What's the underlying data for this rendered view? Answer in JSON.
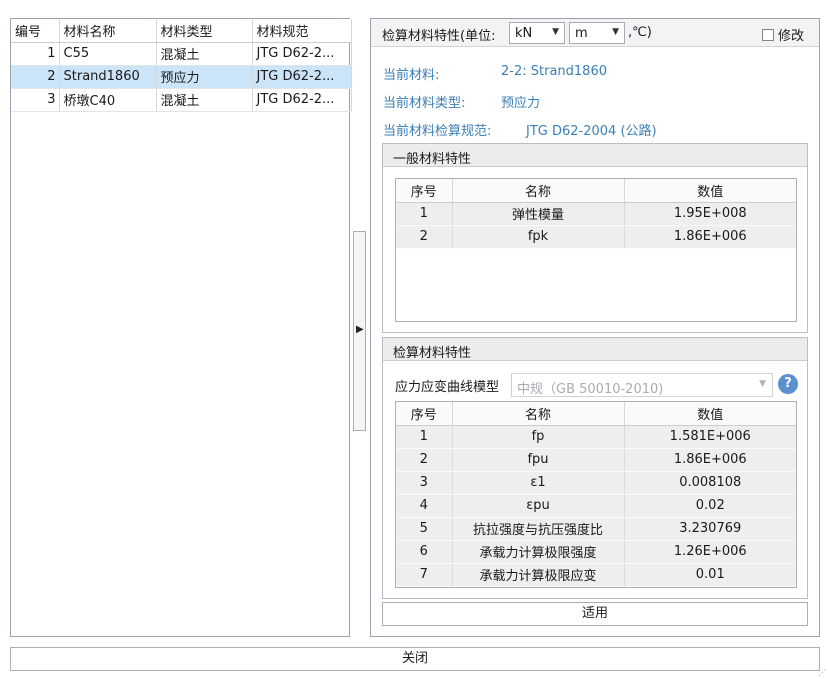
{
  "material_table": {
    "columns": [
      "编号",
      "材料名称",
      "材料类型",
      "材料规范"
    ],
    "rows": [
      {
        "id": "1",
        "name": "C55",
        "type": "混凝土",
        "spec": "JTG D62-2..."
      },
      {
        "id": "2",
        "name": "Strand1860",
        "type": "预应力",
        "spec": "JTG D62-2..."
      },
      {
        "id": "3",
        "name": "桥墩C40",
        "type": "混凝土",
        "spec": "JTG D62-2..."
      }
    ],
    "selected_row": 1
  },
  "splitter": {
    "arrow": "▶"
  },
  "panel": {
    "title": "检算材料特性(单位:",
    "unit_force": "kN",
    "unit_length": "m",
    "unit_temp": ",℃)",
    "modify_label": "修改",
    "modify_checked": false,
    "current_material_label": "当前材料:",
    "current_material_value": "2-2: Strand1860",
    "current_type_label": "当前材料类型:",
    "current_type_value": "预应力",
    "current_spec_label": "当前材料检算规范:",
    "current_spec_value": "JTG D62-2004 (公路)"
  },
  "general_group": {
    "title": "一般材料特性",
    "columns": [
      "序号",
      "名称",
      "数值"
    ],
    "rows": [
      {
        "no": "1",
        "name": "弹性模量",
        "value": "1.95E+008"
      },
      {
        "no": "2",
        "name": "fpk",
        "value": "1.86E+006"
      }
    ]
  },
  "check_group": {
    "title": "检算材料特性",
    "model_label": "应力应变曲线模型",
    "model_value": "中规（GB 50010-2010)",
    "help_icon": "?",
    "columns": [
      "序号",
      "名称",
      "数值"
    ],
    "rows": [
      {
        "no": "1",
        "name": "fp",
        "value": "1.581E+006"
      },
      {
        "no": "2",
        "name": "fpu",
        "value": "1.86E+006"
      },
      {
        "no": "3",
        "name": "ε1",
        "value": "0.008108"
      },
      {
        "no": "4",
        "name": "εpu",
        "value": "0.02"
      },
      {
        "no": "5",
        "name": "抗拉强度与抗压强度比",
        "value": "3.230769"
      },
      {
        "no": "6",
        "name": "承载力计算极限强度",
        "value": "1.26E+006"
      },
      {
        "no": "7",
        "name": "承载力计算极限应变",
        "value": "0.01"
      }
    ]
  },
  "buttons": {
    "apply": "适用",
    "close": "关闭"
  }
}
